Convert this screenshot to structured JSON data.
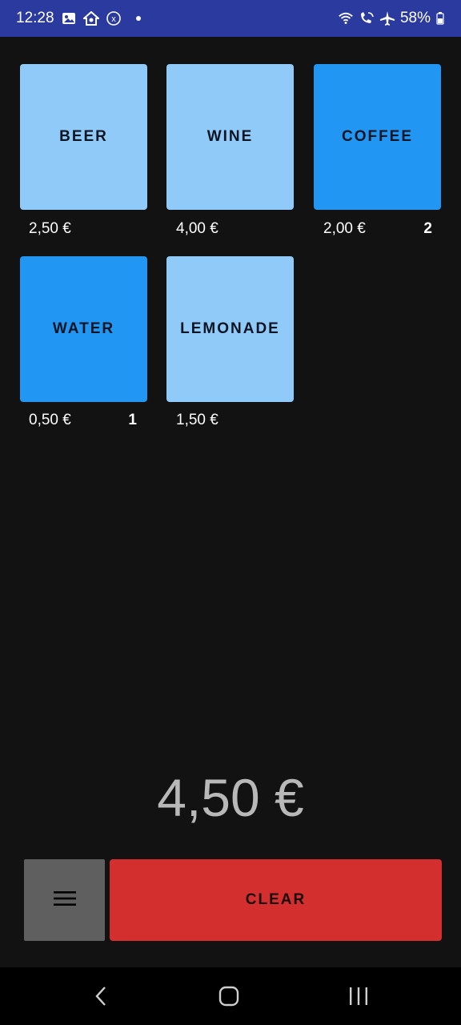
{
  "status_bar": {
    "time": "12:28",
    "battery": "58%",
    "icons": [
      "gallery-icon",
      "home-icon",
      "close-circle-icon",
      "notification-dot",
      "wifi-icon",
      "wifi-calling-icon",
      "airplane-icon",
      "battery-icon"
    ]
  },
  "products": [
    {
      "name": "BEER",
      "price": "2,50 €",
      "count": "",
      "selected": false
    },
    {
      "name": "WINE",
      "price": "4,00 €",
      "count": "",
      "selected": false
    },
    {
      "name": "COFFEE",
      "price": "2,00 €",
      "count": "2",
      "selected": true
    },
    {
      "name": "WATER",
      "price": "0,50 €",
      "count": "1",
      "selected": true
    },
    {
      "name": "LEMONADE",
      "price": "1,50 €",
      "count": "",
      "selected": false
    }
  ],
  "total": "4,50 €",
  "actions": {
    "menu_icon": "hamburger-menu-icon",
    "clear_label": "CLEAR"
  },
  "colors": {
    "status_bar": "#2b3a9e",
    "tile_default": "#90caf9",
    "tile_selected": "#2196f3",
    "clear": "#d32f2f",
    "menu": "#5f5f5f",
    "background": "#121212"
  },
  "nav": {
    "icons": [
      "back-icon",
      "home-icon",
      "recents-icon"
    ]
  }
}
